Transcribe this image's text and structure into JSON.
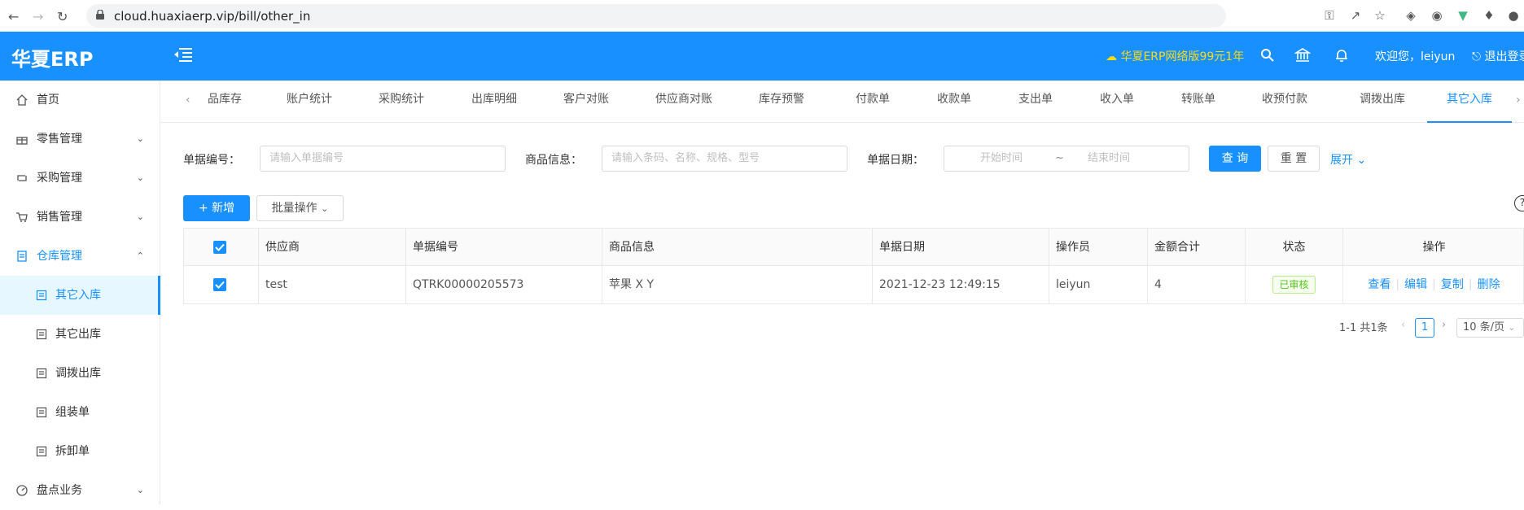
{
  "browser": {
    "url": "cloud.huaxiaerp.vip/bill/other_in"
  },
  "header": {
    "logo": "华夏ERP",
    "promo": "华夏ERP网络版99元1年",
    "welcome": "欢迎您，leiyun",
    "logout": "退出登录"
  },
  "sidebar": {
    "items": [
      {
        "label": "首页",
        "icon": "home-icon"
      },
      {
        "label": "零售管理",
        "icon": "gift-icon"
      },
      {
        "label": "采购管理",
        "icon": "retweet-icon"
      },
      {
        "label": "销售管理",
        "icon": "cart-icon"
      },
      {
        "label": "仓库管理",
        "icon": "file-icon"
      },
      {
        "label": "其它入库",
        "icon": "profile-icon"
      },
      {
        "label": "其它出库",
        "icon": "profile-icon"
      },
      {
        "label": "调拨出库",
        "icon": "profile-icon"
      },
      {
        "label": "组装单",
        "icon": "profile-icon"
      },
      {
        "label": "拆卸单",
        "icon": "profile-icon"
      },
      {
        "label": "盘点业务",
        "icon": "dashboard-icon"
      }
    ]
  },
  "tabs": [
    "品库存",
    "账户统计",
    "采购统计",
    "出库明细",
    "客户对账",
    "供应商对账",
    "库存预警",
    "付款单",
    "收款单",
    "支出单",
    "收入单",
    "转账单",
    "收预付款",
    "调拨出库",
    "其它入库"
  ],
  "search": {
    "bill_no_label": "单据编号：",
    "bill_no_placeholder": "请输入单据编号",
    "goods_label": "商品信息：",
    "goods_placeholder": "请输入条码、名称、规格、型号",
    "date_label": "单据日期：",
    "date_start": "开始时间",
    "date_sep": "~",
    "date_end": "结束时间",
    "query": "查 询",
    "reset": "重 置",
    "expand": "展开"
  },
  "toolbar": {
    "add": "新增",
    "batch": "批量操作"
  },
  "table": {
    "columns": [
      "供应商",
      "单据编号",
      "商品信息",
      "单据日期",
      "操作员",
      "金额合计",
      "状态",
      "操作"
    ],
    "rows": [
      {
        "supplier": "test",
        "bill_no": "QTRK00000205573",
        "goods": "苹果 X Y",
        "date": "2021-12-23 12:49:15",
        "operator": "leiyun",
        "amount": "4",
        "status": "已审核",
        "actions": [
          "查看",
          "编辑",
          "复制",
          "删除"
        ]
      }
    ]
  },
  "pagination": {
    "summary": "1-1 共1条",
    "current": "1",
    "page_size": "10 条/页"
  }
}
